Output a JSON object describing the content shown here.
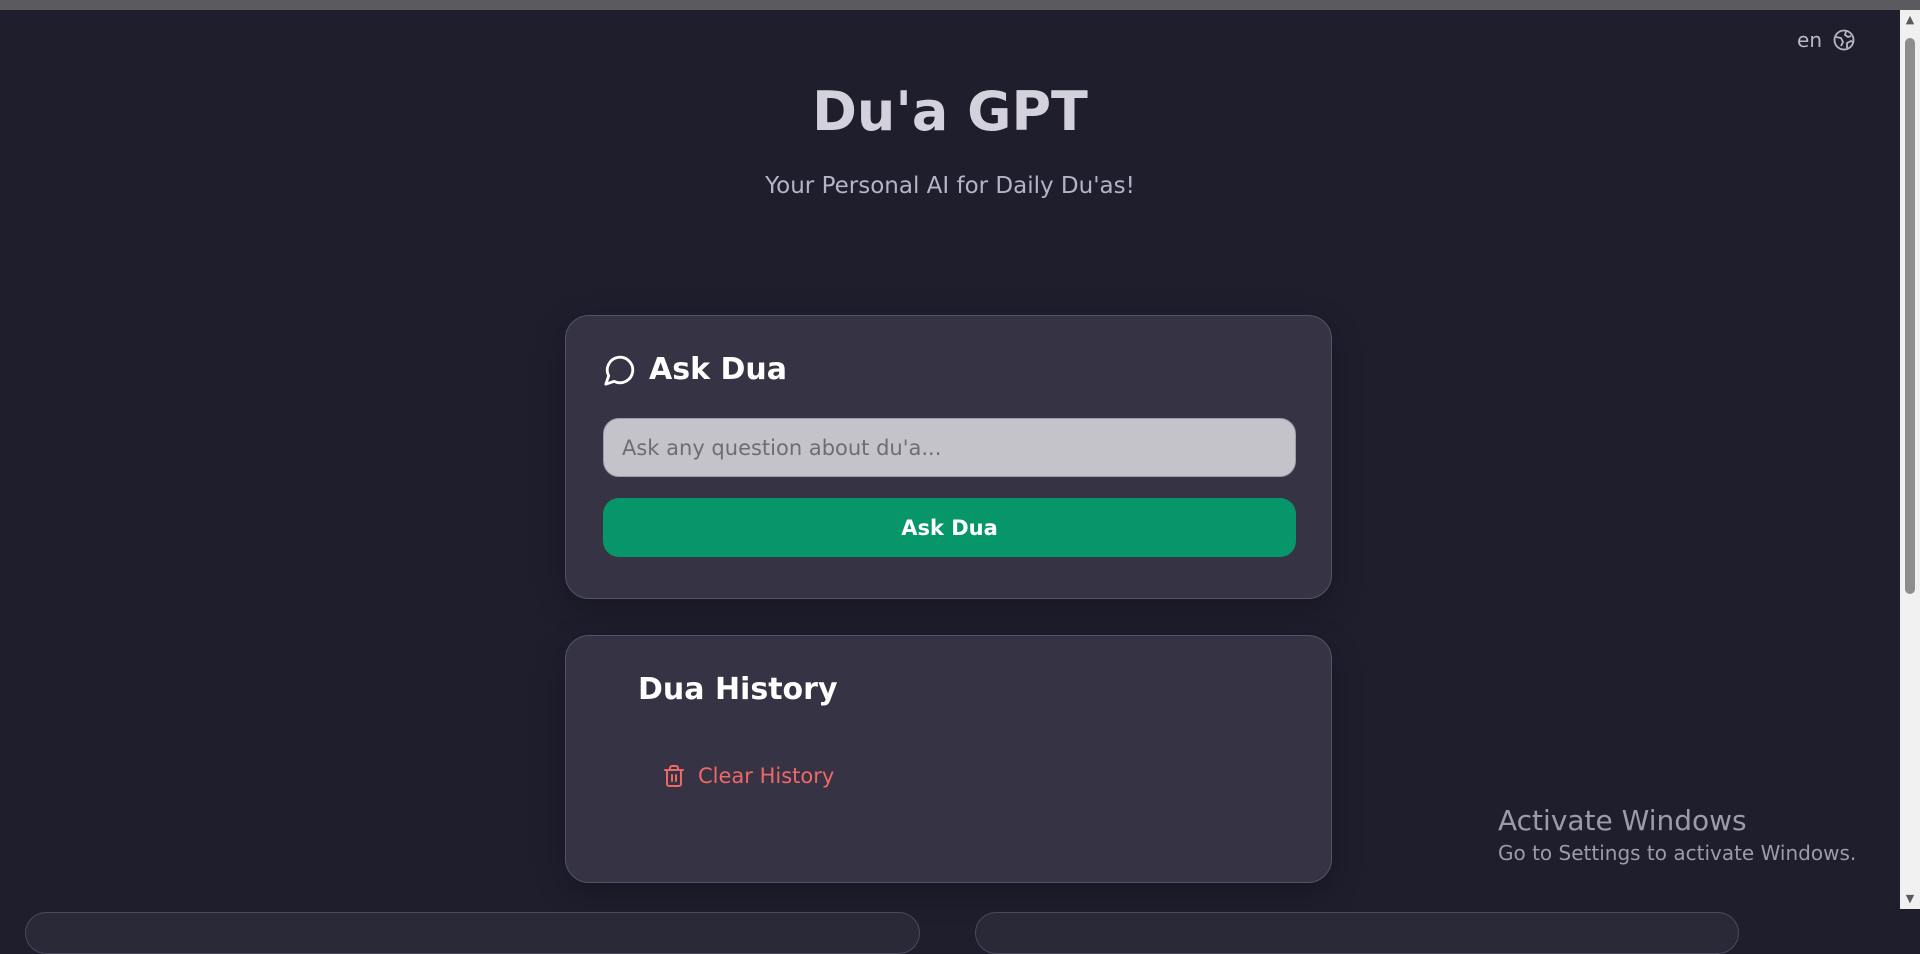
{
  "header": {
    "language": "en",
    "language_icon": "globe-icon",
    "title": "Du'a GPT",
    "subtitle": "Your Personal AI for Daily Du'as!"
  },
  "ask_card": {
    "icon": "chat-bubble-icon",
    "title": "Ask Dua",
    "input_placeholder": "Ask any question about du'a...",
    "input_value": "",
    "button_label": "Ask Dua"
  },
  "history_card": {
    "title": "Dua History",
    "clear_icon": "trash-icon",
    "clear_label": "Clear History"
  },
  "watermark": {
    "title": "Activate Windows",
    "subtitle": "Go to Settings to activate Windows."
  },
  "colors": {
    "background": "#1f1e2d",
    "card": "#363444",
    "accent_green": "#069669",
    "danger": "#ef6868"
  }
}
